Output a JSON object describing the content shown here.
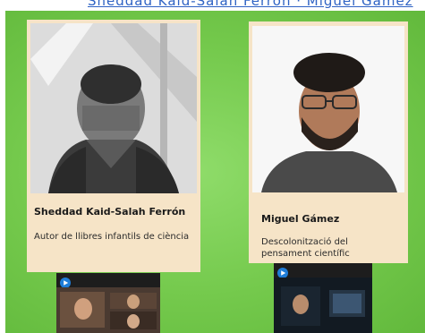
{
  "top_link": {
    "text": "Sheddad Kaid-Salah Ferrón · Miguel Gámez"
  },
  "icons": {
    "app_badge": "video-call-app-icon"
  },
  "colors": {
    "background_green": "#74c94c",
    "card_beige": "#f6e4c7",
    "link_blue": "#2f63c4"
  },
  "cards": [
    {
      "name": "Sheddad Kaid-Salah Ferrón",
      "description": "Autor de llibres infantils de ciència"
    },
    {
      "name": "Miguel Gámez",
      "description": "Descolonització del pensament científic"
    }
  ]
}
